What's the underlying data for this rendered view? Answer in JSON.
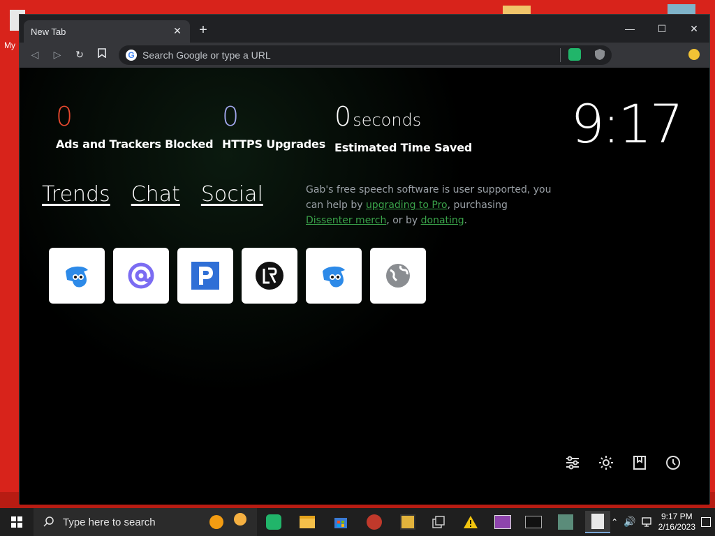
{
  "desktop": {
    "icon_label": "My"
  },
  "browser": {
    "tab_title": "New Tab",
    "tab_close": "✕",
    "new_tab": "+",
    "minimize": "—",
    "maximize": "☐",
    "close": "✕",
    "omnibox_placeholder": "Search Google or type a URL"
  },
  "stats": [
    {
      "value": "0",
      "unit": "",
      "label": "Ads and Trackers Blocked",
      "color": "#e8482e"
    },
    {
      "value": "0",
      "unit": "",
      "label": "HTTPS Upgrades",
      "color": "#a0a5eb"
    },
    {
      "value": "0",
      "unit": "seconds",
      "label": "Estimated Time Saved",
      "color": "#ffffff"
    }
  ],
  "clock": "9:17",
  "nav_links": [
    "Trends",
    "Chat",
    "Social"
  ],
  "sponsor": {
    "prefix": "Gab's free speech software is user supported, you can help by ",
    "link1": "upgrading to Pro",
    "middle": ", purchasing ",
    "link2": "Dissenter merch",
    "middle2": ", or by ",
    "link3": "donating",
    "suffix": "."
  },
  "tiles": [
    {
      "name": "gab-frog-icon"
    },
    {
      "name": "at-sign-icon"
    },
    {
      "name": "p-logo-icon"
    },
    {
      "name": "lr-logo-icon"
    },
    {
      "name": "gab-frog-icon"
    },
    {
      "name": "globe-icon"
    }
  ],
  "taskbar": {
    "search_placeholder": "Type here to search",
    "time": "9:17 PM",
    "date": "2/16/2023"
  },
  "colors": {
    "desktop_bg": "#d8231b",
    "link_green": "#3aa34a",
    "stat_red": "#e8482e",
    "stat_purple": "#a0a5eb"
  }
}
